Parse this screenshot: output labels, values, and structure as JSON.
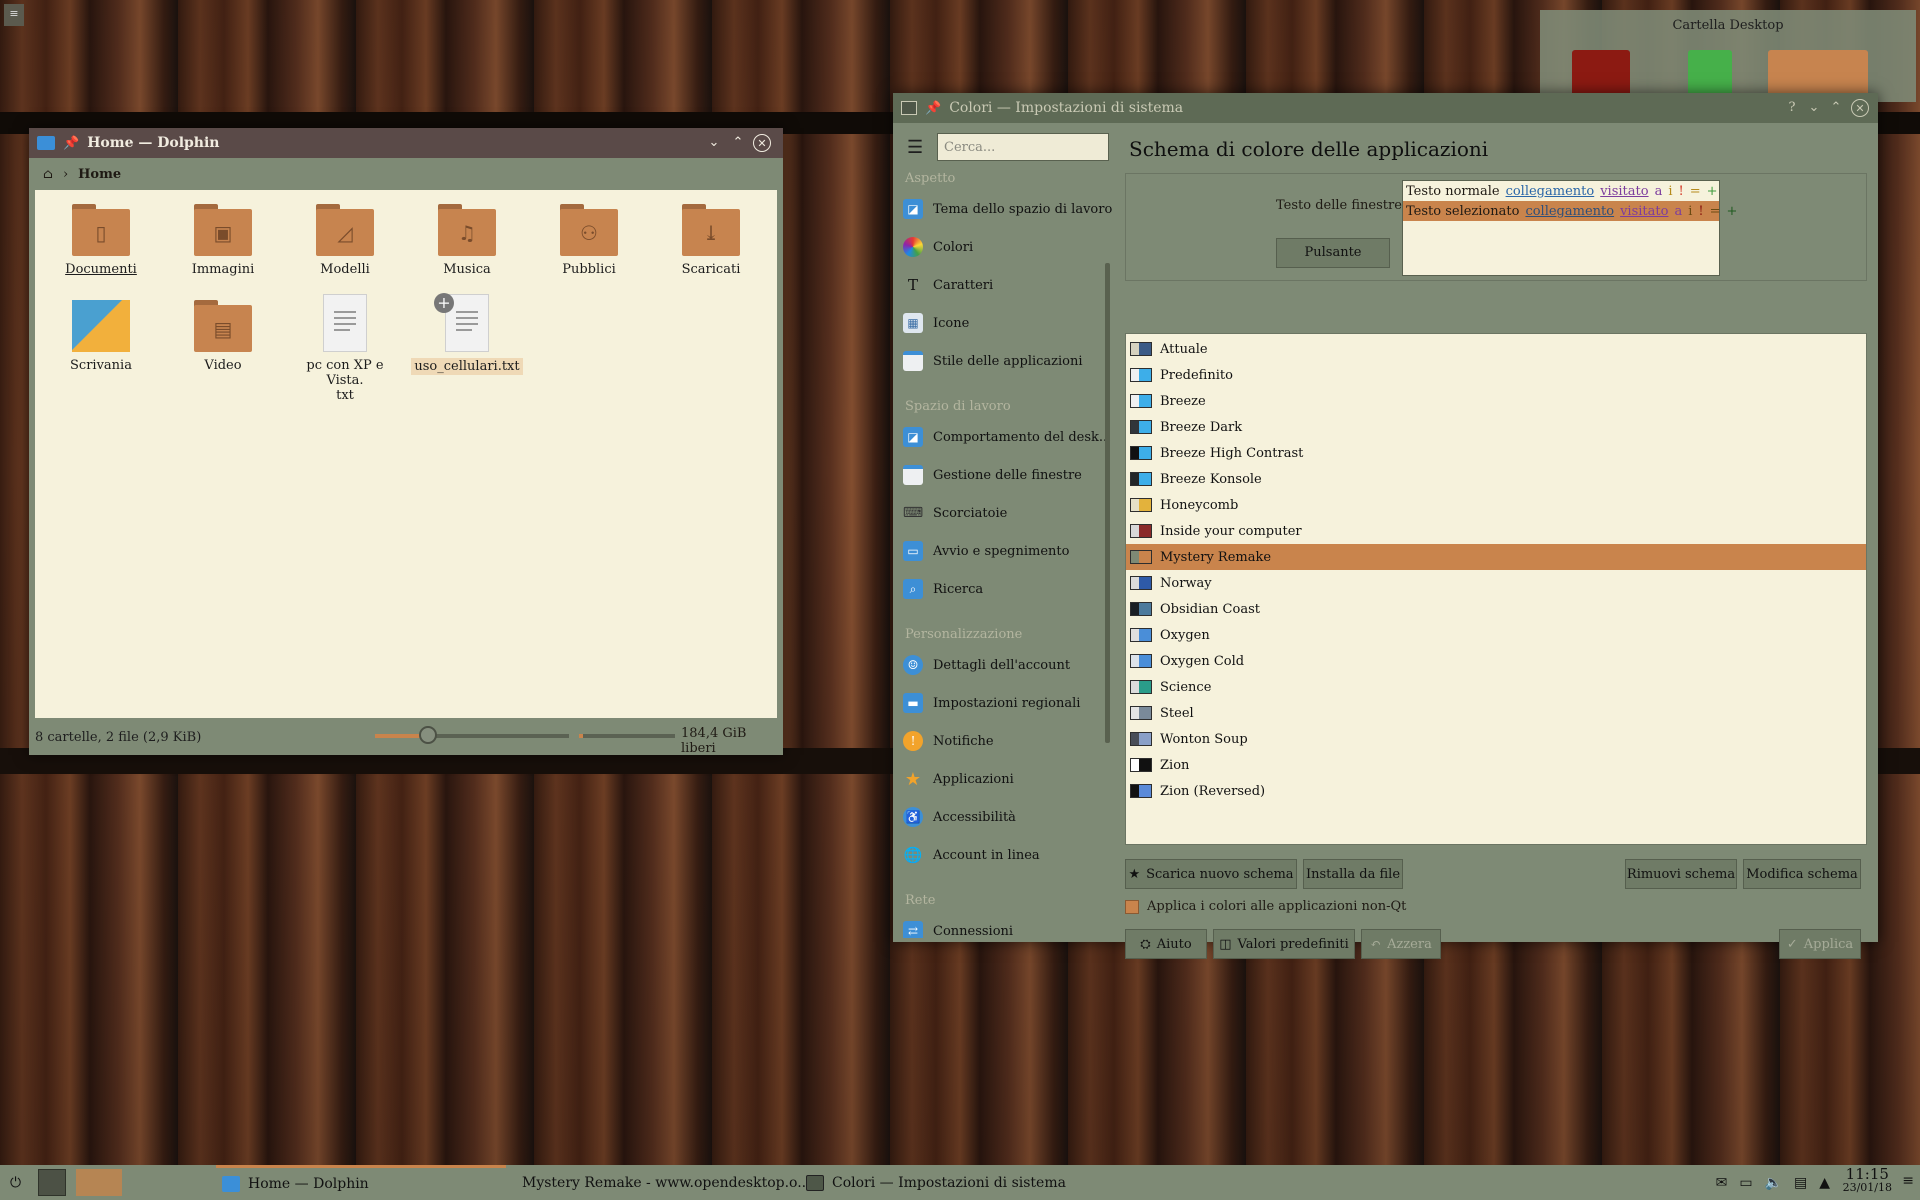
{
  "desktop_folder": {
    "title": "Cartella Desktop"
  },
  "dolphin": {
    "title": "Home — Dolphin",
    "breadcrumb": "Home",
    "items": [
      {
        "label": "Documenti",
        "icon": "folder-documents-icon"
      },
      {
        "label": "Immagini",
        "icon": "folder-pictures-icon"
      },
      {
        "label": "Modelli",
        "icon": "folder-templates-icon"
      },
      {
        "label": "Musica",
        "icon": "folder-music-icon"
      },
      {
        "label": "Pubblici",
        "icon": "folder-public-icon"
      },
      {
        "label": "Scaricati",
        "icon": "folder-download-icon"
      },
      {
        "label": "Scrivania",
        "icon": "desktop-folder-icon"
      },
      {
        "label": "Video",
        "icon": "folder-video-icon"
      },
      {
        "label": "pc con XP e Vista.\ntxt",
        "icon": "text-file-icon"
      },
      {
        "label": "uso_cellulari.txt",
        "icon": "text-file-icon"
      }
    ],
    "status": "8 cartelle, 2 file (2,9 KiB)",
    "free_space": "184,4 GiB liberi"
  },
  "settings": {
    "title": "Colori — Impostazioni di sistema",
    "search_placeholder": "Cerca...",
    "sections": {
      "aspetto": "Aspetto",
      "spazio": "Spazio di lavoro",
      "personal": "Personalizzazione",
      "rete": "Rete"
    },
    "sidebar": {
      "tema": "Tema dello spazio di lavoro",
      "colori": "Colori",
      "caratteri": "Caratteri",
      "icone": "Icone",
      "stile": "Stile delle applicazioni",
      "comportamento": "Comportamento del desk...",
      "finestre": "Gestione delle finestre",
      "scorciatoie": "Scorciatoie",
      "avvio": "Avvio e spegnimento",
      "ricerca": "Ricerca",
      "account": "Dettagli dell'account",
      "regionali": "Impostazioni regionali",
      "notifiche": "Notifiche",
      "applicazioni": "Applicazioni",
      "accessibilita": "Accessibilità",
      "online": "Account in linea",
      "connessioni": "Connessioni"
    },
    "heading": "Schema di colore delle applicazioni",
    "preview": {
      "window_text_label": "Testo delle finestre",
      "button_label": "Pulsante",
      "normal_text": "Testo normale",
      "selected_text": "Testo selezionato",
      "link": "collegamento",
      "visited": "visitato",
      "a": "a",
      "i": "i",
      "bang": "!",
      "eq": "=",
      "plus": "+"
    },
    "schemes": [
      "Attuale",
      "Predefinito",
      "Breeze",
      "Breeze Dark",
      "Breeze High Contrast",
      "Breeze Konsole",
      "Honeycomb",
      "Inside your computer",
      "Mystery Remake",
      "Norway",
      "Obsidian Coast",
      "Oxygen",
      "Oxygen Cold",
      "Science",
      "Steel",
      "Wonton Soup",
      "Zion",
      "Zion (Reversed)"
    ],
    "selected_scheme": "Mystery Remake",
    "buttons": {
      "download": "Scarica nuovo schema",
      "install": "Installa da file",
      "remove": "Rimuovi schema",
      "edit": "Modifica schema",
      "help": "Aiuto",
      "defaults": "Valori predefiniti",
      "reset": "Azzera",
      "apply": "Applica"
    },
    "apply_non_qt_label": "Applica i colori alle applicazioni non-Qt",
    "apply_non_qt_checked": true
  },
  "taskbar": {
    "tasks": {
      "dolphin": "Home — Dolphin",
      "firefox": "Mystery Remake - www.opendesktop.o...",
      "settings": "Colori  — Impostazioni di sistema"
    },
    "time": "11:15",
    "date": "23/01/18"
  },
  "colors": {
    "accent": "#c9844c",
    "window_bg": "#7e8a75",
    "view_bg": "#f6f2dc",
    "dolphin_title": "#5a4a48"
  }
}
